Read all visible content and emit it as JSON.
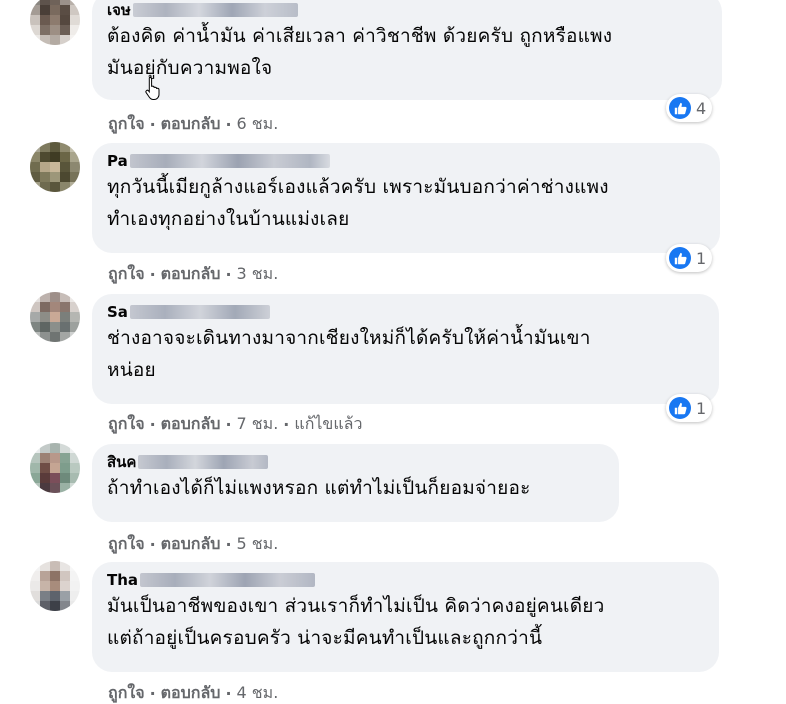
{
  "labels": {
    "like": "ถูกใจ",
    "reply": "ตอบกลับ",
    "separator": "·"
  },
  "comments": [
    {
      "author_visible": "เจษ",
      "lines": [
        "ต้องคิด ค่าน้ำมัน ค่าเสียเวลา ค่าวิชาชีพ ด้วยครับ ถูกหรือแพง",
        "มันอยู่กับความพอใจ"
      ],
      "reaction_count": "4",
      "time": "6 ชม.",
      "edited": ""
    },
    {
      "author_visible": "Pa",
      "lines": [
        "ทุกวันนี้เมียกูล้างแอร์เองแล้วครับ เพราะมันบอกว่าค่าช่างแพง",
        "ทำเองทุกอย่างในบ้านแม่งเลย"
      ],
      "reaction_count": "1",
      "time": "3 ชม.",
      "edited": ""
    },
    {
      "author_visible": "Sa",
      "lines": [
        "ช่างอาจจะเดินทางมาจากเชียงใหม่ก็ได้ครับให้ค่าน้ำมันเขา",
        "หน่อย"
      ],
      "reaction_count": "1",
      "time": "7 ชม.",
      "edited": "แก้ไขแล้ว"
    },
    {
      "author_visible": "สินค",
      "lines": [
        "ถ้าทำเองได้ก็ไม่แพงหรอก แต่ทำไม่เป็นก็ยอมจ่ายอะ"
      ],
      "reaction_count": "",
      "time": "5 ชม.",
      "edited": ""
    },
    {
      "author_visible": "Tha",
      "lines": [
        "มันเป็นอาชีพของเขา ส่วนเราก็ทำไม่เป็น คิดว่าคงอยู่คนเดียว",
        "แต่ถ้าอยู่เป็นครอบครัว น่าจะมีคนทำเป็นและถูกกว่านี้"
      ],
      "reaction_count": "",
      "time": "4 ชม.",
      "edited": ""
    }
  ],
  "colors": {
    "bubble": "#f0f2f5",
    "like_blue": "#1877f2",
    "secondary_text": "#65676b"
  }
}
